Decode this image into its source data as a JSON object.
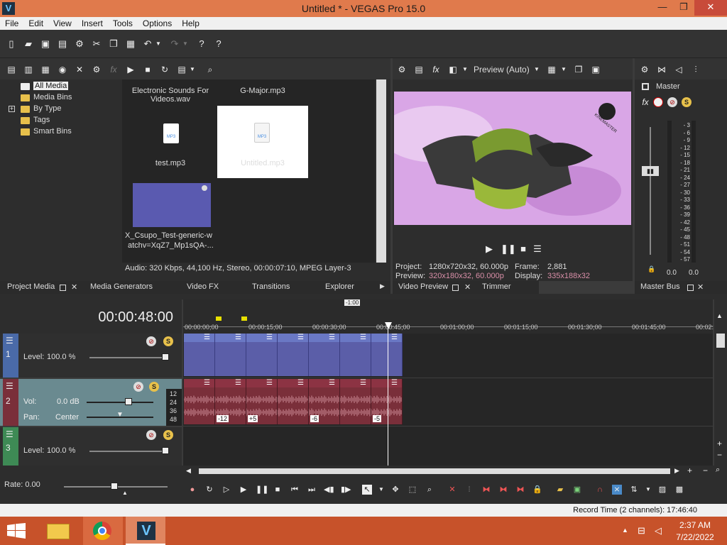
{
  "window": {
    "title": "Untitled * - VEGAS Pro 15.0",
    "app_icon": "V",
    "minimize": "—",
    "restore": "❐",
    "close": "✕"
  },
  "menu": [
    "File",
    "Edit",
    "View",
    "Insert",
    "Tools",
    "Options",
    "Help"
  ],
  "project_media": {
    "tree": [
      {
        "label": "All Media"
      },
      {
        "label": "Media Bins"
      },
      {
        "label": "By Type",
        "expander": "+"
      },
      {
        "label": "Tags"
      },
      {
        "label": "Smart Bins"
      }
    ],
    "items": {
      "electronic": "Electronic Sounds For Videos.wav",
      "gmajor": "G-Major.mp3",
      "test": "test.mp3",
      "untitled": "Untitled.mp3",
      "xcsupo_line1": "X_Csupo_Test-generic-w",
      "xcsupo_line2": "atchv=XqZ7_Mp1sQA-..."
    },
    "mp3_badge": "MP3",
    "status": "Audio: 320 Kbps, 44,100 Hz, Stereo, 00:00:07:10, MPEG Layer-3"
  },
  "tabs_left": {
    "project_media": "Project Media",
    "media_generators": "Media Generators",
    "video_fx": "Video FX",
    "transitions": "Transitions",
    "explorer": "Explorer"
  },
  "preview": {
    "mode": "Preview (Auto)",
    "project_label": "Project:",
    "project_value": "1280x720x32, 60.000p",
    "frame_label": "Frame:",
    "frame_value": "2,881",
    "preview_label": "Preview:",
    "preview_value": "320x180x32, 60.000p",
    "display_label": "Display:",
    "display_value": "335x188x32",
    "watermark": "KINEMASTER",
    "tab_video_preview": "Video Preview",
    "tab_trimmer": "Trimmer"
  },
  "master": {
    "label": "Master",
    "tab": "Master Bus",
    "meter_scale": [
      "3",
      "6",
      "9",
      "12",
      "15",
      "18",
      "21",
      "24",
      "27",
      "30",
      "33",
      "36",
      "39",
      "42",
      "45",
      "48",
      "51",
      "54",
      "57"
    ],
    "left_value": "0.0",
    "right_value": "0.0"
  },
  "timeline": {
    "timecode": "00:00:48:00",
    "marker": "-1:00",
    "ruler": [
      "00:00:00;00",
      "00:00:15;00",
      "00:00:30;00",
      "00:00:45;00",
      "00:01:00;00",
      "00:01:15;00",
      "00:01:30;00",
      "00:01:45;00",
      "00:02:"
    ],
    "tracks": [
      {
        "num": "1",
        "level_label": "Level:",
        "level_value": "100.0 %"
      },
      {
        "num": "2",
        "vol_label": "Vol:",
        "vol_value": "0.0 dB",
        "pan_label": "Pan:",
        "pan_value": "Center",
        "meter": [
          "12",
          "24",
          "36",
          "48"
        ]
      },
      {
        "num": "3",
        "level_label": "Level:",
        "level_value": "100.0 %"
      }
    ],
    "audio_clip_values": [
      "-12",
      "+5",
      "-6",
      "-5"
    ],
    "rate": "Rate: 0.00"
  },
  "status_bar": {
    "record_time": "Record Time (2 channels): 17:46:40"
  },
  "taskbar": {
    "time": "2:37 AM",
    "date": "7/22/2022"
  },
  "colors": {
    "titlebar": "#e07a4c",
    "taskbar": "#c7522a",
    "video_track": "#5b5ea8",
    "audio_track": "#7a2f3a"
  }
}
